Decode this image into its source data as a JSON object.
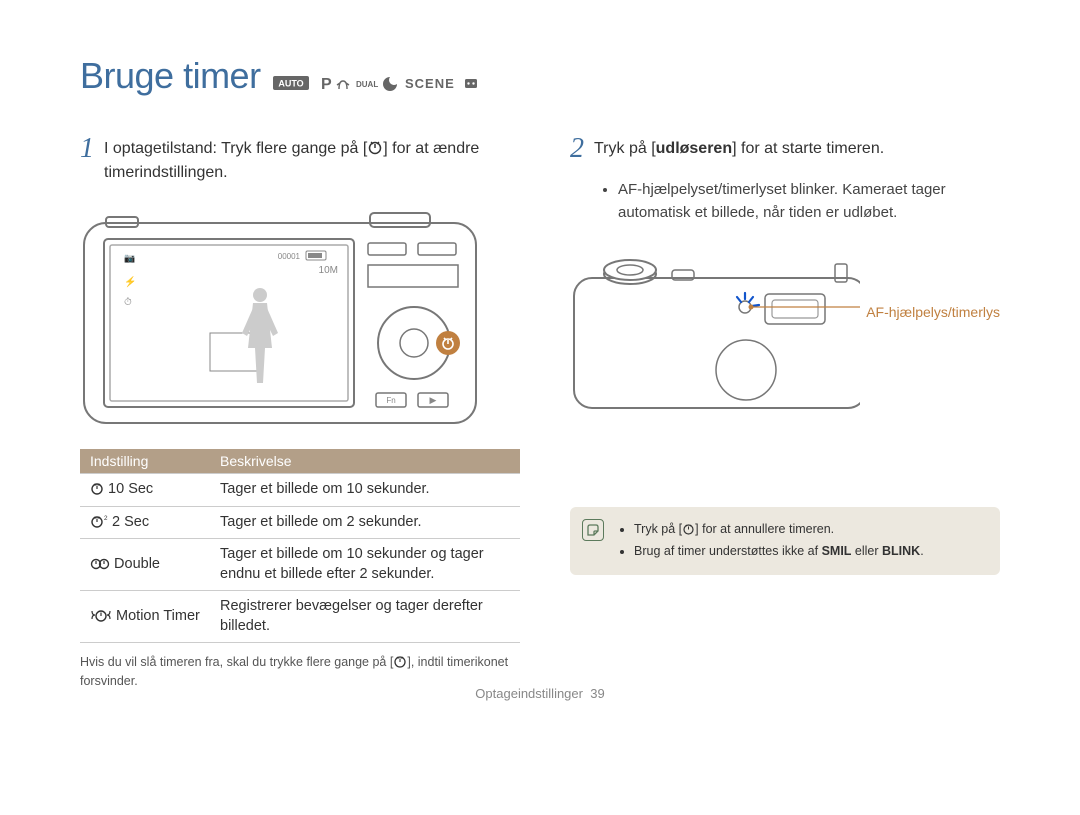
{
  "title": "Bruge timer",
  "mode_icons": [
    "AUTO",
    "P",
    "hand",
    "DUAL",
    "night",
    "SCENE",
    "movie"
  ],
  "steps": {
    "1": {
      "num": "1",
      "text_pre": "I optagetilstand: Tryk flere gange på [",
      "text_post": "] for at ændre timerindstillingen."
    },
    "2": {
      "num": "2",
      "text_pre": "Tryk på [",
      "trigger_word": "udløseren",
      "text_post": "] for at starte timeren.",
      "bullet": "AF-hjælpelyset/timerlyset blinker. Kameraet tager automatisk et billede, når tiden er udløbet."
    }
  },
  "callout": "AF-hjælpelys/timerlys",
  "table": {
    "headers": {
      "setting": "Indstilling",
      "description": "Beskrivelse"
    },
    "rows": [
      {
        "label": "10 Sec",
        "desc": "Tager et billede om 10 sekunder."
      },
      {
        "label": "2 Sec",
        "desc": "Tager et billede om 2 sekunder."
      },
      {
        "label": "Double",
        "desc": "Tager et billede om 10 sekunder og tager endnu et billede efter 2 sekunder."
      },
      {
        "label": "Motion Timer",
        "desc": "Registrerer bevægelser og tager derefter billedet."
      }
    ]
  },
  "footnote_pre": "Hvis du vil slå timeren fra, skal du trykke flere gange på [",
  "footnote_post": "], indtil timerikonet forsvinder.",
  "infobox": {
    "item1_pre": "Tryk på [",
    "item1_post": "] for at annullere timeren.",
    "item2_pre": "Brug af timer understøttes ikke af ",
    "item2_b1": "SMIL",
    "item2_mid": " eller ",
    "item2_b2": "BLINK",
    "item2_post": "."
  },
  "footer": {
    "section": "Optageindstillinger",
    "page": "39"
  }
}
